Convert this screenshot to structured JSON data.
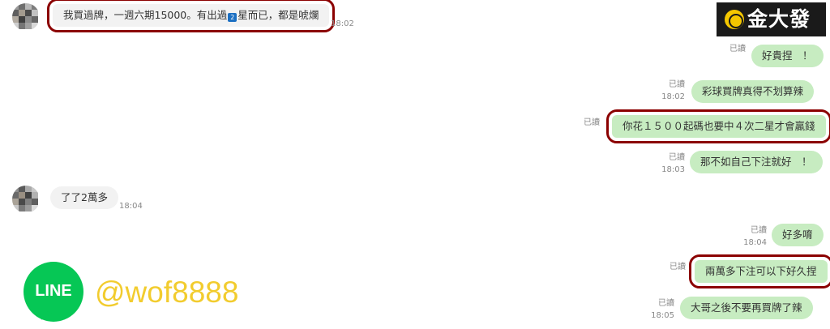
{
  "brand": {
    "name": "金大發"
  },
  "messages": [
    {
      "side": "in",
      "text_a": "我買過牌，一週六期15000。有出過",
      "badge": "2",
      "text_b": "星而已，都是唬爛",
      "time": "18:02"
    },
    {
      "side": "out",
      "read": "已讀",
      "text": "好貴捏　！"
    },
    {
      "side": "out",
      "read": "已讀",
      "time": "18:02",
      "text": "彩球買牌真得不划算辣"
    },
    {
      "side": "out",
      "read": "已讀",
      "text": "你花１５００起碼也要中４次二星才會贏錢"
    },
    {
      "side": "out",
      "read": "已讀",
      "time": "18:03",
      "text": "那不如自己下注就好　！"
    },
    {
      "side": "in",
      "text": "了了2萬多",
      "time": "18:04"
    },
    {
      "side": "out",
      "read": "已讀",
      "time": "18:04",
      "text": "好多唷"
    },
    {
      "side": "out",
      "read": "已讀",
      "text": "兩萬多下注可以下好久捏"
    },
    {
      "side": "out",
      "read": "已讀",
      "time": "18:05",
      "text": "大哥之後不要再買牌了辣"
    }
  ],
  "promo": {
    "line_label": "LINE",
    "handle": "@wof8888"
  }
}
